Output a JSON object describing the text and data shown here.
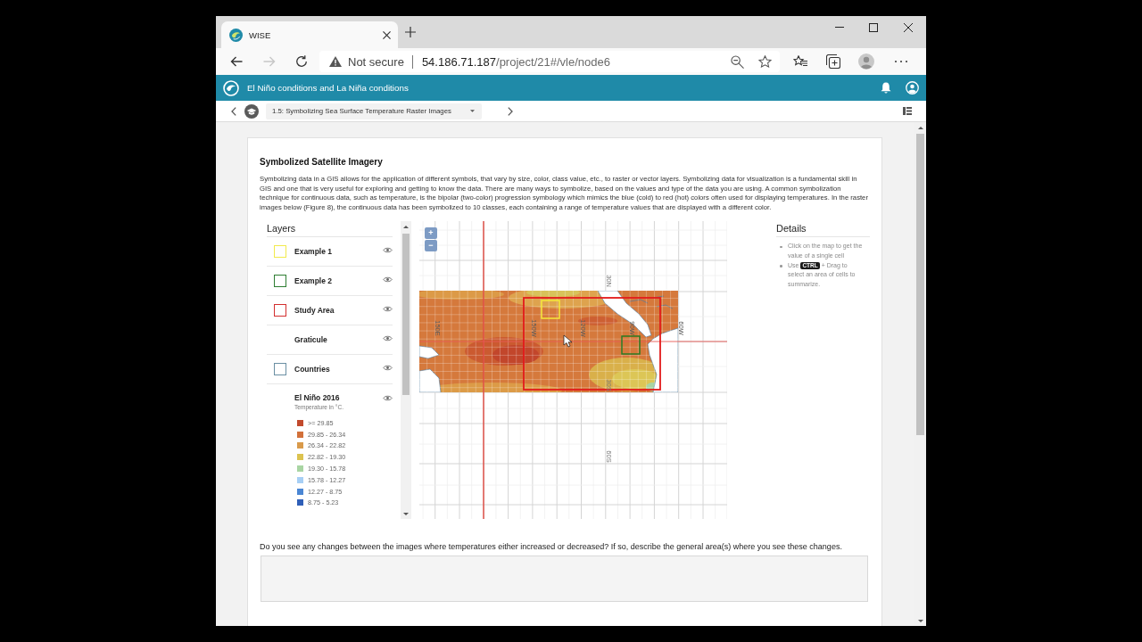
{
  "browser": {
    "tab_title": "WISE",
    "security_label": "Not secure",
    "url_host": "54.186.71.187",
    "url_path": "/project/21#/vle/node6"
  },
  "app_bar": {
    "title": "El Niño conditions and La Niña conditions"
  },
  "step_nav": {
    "step": "1.5: Symbolizing Sea Surface Temperature Raster Images"
  },
  "content": {
    "heading": "Symbolized Satellite Imagery",
    "paragraph": "Symbolizing data in a GIS allows for the application of different symbols, that vary by size, color, class value, etc., to raster or vector layers. Symbolizing data for visualization is a fundamental skill in GIS and one that is very useful for exploring and getting to know the data. There are many ways to symbolize, based on the values and type of the data you are using. A common symbolization technique for continuous data, such as temperature, is the bipolar (two-color) progression symbology which mimics the blue (cold) to red (hot) colors often used for displaying temperatures. In the raster images below (Figure 8), the continuous data has been symbolized to 10 classes, each containing a range of temperature values that are displayed with a different color.",
    "layers": {
      "title": "Layers",
      "items": [
        {
          "kind": "outline",
          "label": "Example 1",
          "color": "#f2ea4c"
        },
        {
          "kind": "outline",
          "label": "Example 2",
          "color": "#2e7d32"
        },
        {
          "kind": "outline",
          "label": "Study Area",
          "color": "#d32f2f"
        },
        {
          "kind": "plain",
          "label": "Graticule"
        },
        {
          "kind": "outline",
          "label": "Countries",
          "color": "#6a8fa3"
        },
        {
          "kind": "classified",
          "label": "El Niño 2016",
          "subtitle": "Temperature in °C.",
          "legend": [
            {
              "label": ">= 29.85",
              "color": "#c24a2d"
            },
            {
              "label": "29.85 - 26.34",
              "color": "#d2703a"
            },
            {
              "label": "26.34 - 22.82",
              "color": "#d99a4b"
            },
            {
              "label": "22.82 - 19.30",
              "color": "#dcc350"
            },
            {
              "label": "19.30 - 15.78",
              "color": "#a9d5a3"
            },
            {
              "label": "15.78 - 12.27",
              "color": "#a7cff5"
            },
            {
              "label": "12.27 - 8.75",
              "color": "#4a86d4"
            },
            {
              "label": "8.75 - 5.23",
              "color": "#2f5fb8"
            }
          ]
        }
      ]
    },
    "map": {
      "zoom_controls": [
        "+",
        "−"
      ],
      "graticule": {
        "lat_labels": [
          "30N",
          "30S",
          "60S"
        ],
        "lon_labels": [
          "150E",
          "150W",
          "120W",
          "90W",
          "60W"
        ]
      }
    },
    "details": {
      "title": "Details",
      "hints": [
        {
          "kind": "text",
          "text": "Click on the map to get the value of a single cell"
        },
        {
          "kind": "shortcut",
          "before": "Use",
          "key": "CTRL",
          "after": "+ Drag to select an area of cells to summarize."
        }
      ]
    },
    "question": {
      "prompt": "Do you see any changes between the images where temperatures either increased or decreased? If so, describe the general area(s) where you see these changes."
    }
  }
}
